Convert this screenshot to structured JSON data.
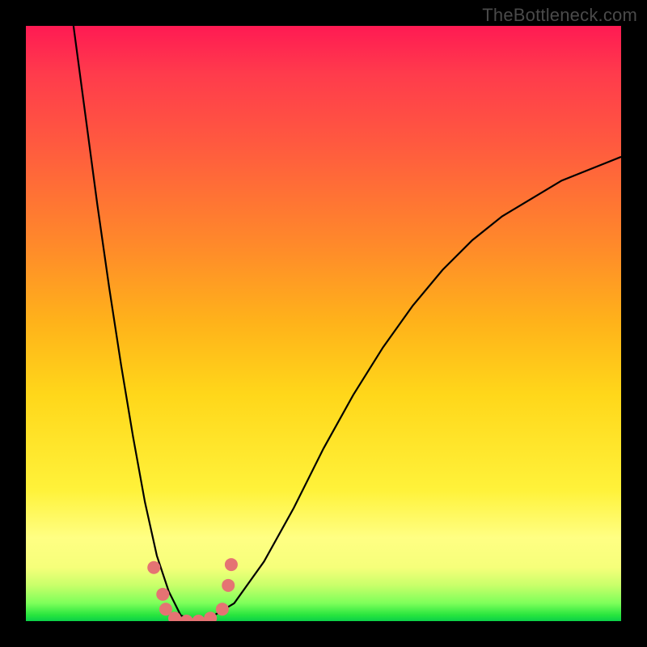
{
  "watermark": "TheBottleneck.com",
  "chart_data": {
    "type": "line",
    "title": "",
    "xlabel": "",
    "ylabel": "",
    "xlim": [
      0,
      100
    ],
    "ylim": [
      0,
      100
    ],
    "grid": false,
    "legend": false,
    "series": [
      {
        "name": "curve",
        "x": [
          8,
          10,
          12,
          14,
          16,
          18,
          20,
          22,
          24,
          26,
          28,
          30,
          35,
          40,
          45,
          50,
          55,
          60,
          65,
          70,
          75,
          80,
          85,
          90,
          95,
          100
        ],
        "y": [
          100,
          85,
          70,
          56,
          43,
          31,
          20,
          11,
          5,
          1,
          0,
          0,
          3,
          10,
          19,
          29,
          38,
          46,
          53,
          59,
          64,
          68,
          71,
          74,
          76,
          78
        ]
      }
    ],
    "markers": [
      {
        "x": 21.5,
        "y": 9.0
      },
      {
        "x": 23.0,
        "y": 4.5
      },
      {
        "x": 23.5,
        "y": 2.0
      },
      {
        "x": 25.0,
        "y": 0.5
      },
      {
        "x": 27.0,
        "y": 0.0
      },
      {
        "x": 29.0,
        "y": 0.0
      },
      {
        "x": 31.0,
        "y": 0.5
      },
      {
        "x": 33.0,
        "y": 2.0
      },
      {
        "x": 34.0,
        "y": 6.0
      },
      {
        "x": 34.5,
        "y": 9.5
      }
    ],
    "marker_color": "#e57373",
    "curve_color": "#000000"
  }
}
